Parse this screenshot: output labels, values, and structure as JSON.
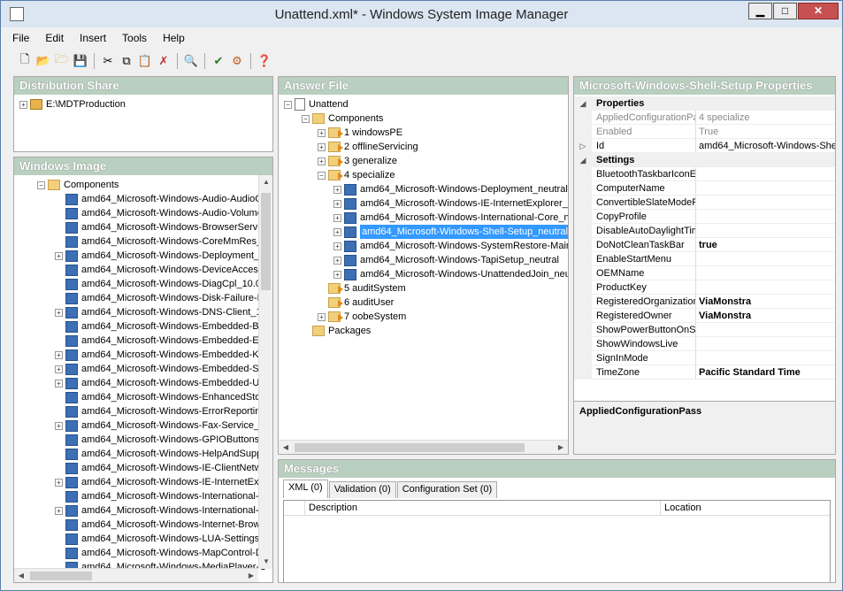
{
  "window": {
    "title": "Unattend.xml* - Windows System Image Manager",
    "minimize": "▁",
    "maximize": "□",
    "close": "✕"
  },
  "menu": [
    "File",
    "Edit",
    "Insert",
    "Tools",
    "Help"
  ],
  "toolbar_icons": [
    "new-icon",
    "open-icon",
    "open-folder-icon",
    "save-icon",
    "cut-icon",
    "copy-icon",
    "paste-icon",
    "delete-icon",
    "find-icon",
    "validate-icon",
    "create-config-set-icon",
    "help-icon"
  ],
  "distribution": {
    "header": "Distribution Share",
    "root": "E:\\MDTProduction"
  },
  "windows_image": {
    "header": "Windows Image",
    "components_label": "Components",
    "items": [
      {
        "label": "amd64_Microsoft-Windows-Audio-AudioC",
        "exp": false
      },
      {
        "label": "amd64_Microsoft-Windows-Audio-Volume",
        "exp": false
      },
      {
        "label": "amd64_Microsoft-Windows-BrowserServic",
        "exp": false
      },
      {
        "label": "amd64_Microsoft-Windows-CoreMmRes_",
        "exp": false
      },
      {
        "label": "amd64_Microsoft-Windows-Deployment_",
        "exp": true
      },
      {
        "label": "amd64_Microsoft-Windows-DeviceAcces",
        "exp": false
      },
      {
        "label": "amd64_Microsoft-Windows-DiagCpl_10.0",
        "exp": false
      },
      {
        "label": "amd64_Microsoft-Windows-Disk-Failure-D",
        "exp": false
      },
      {
        "label": "amd64_Microsoft-Windows-DNS-Client_1",
        "exp": true
      },
      {
        "label": "amd64_Microsoft-Windows-Embedded-Bo",
        "exp": false
      },
      {
        "label": "amd64_Microsoft-Windows-Embedded-Er",
        "exp": false
      },
      {
        "label": "amd64_Microsoft-Windows-Embedded-Ke",
        "exp": true
      },
      {
        "label": "amd64_Microsoft-Windows-Embedded-Sh",
        "exp": true
      },
      {
        "label": "amd64_Microsoft-Windows-Embedded-Ur",
        "exp": true
      },
      {
        "label": "amd64_Microsoft-Windows-EnhancedSto",
        "exp": false
      },
      {
        "label": "amd64_Microsoft-Windows-ErrorReporting",
        "exp": false
      },
      {
        "label": "amd64_Microsoft-Windows-Fax-Service_",
        "exp": true
      },
      {
        "label": "amd64_Microsoft-Windows-GPIOButtons_",
        "exp": false
      },
      {
        "label": "amd64_Microsoft-Windows-HelpAndSupp",
        "exp": false
      },
      {
        "label": "amd64_Microsoft-Windows-IE-ClientNetw",
        "exp": false
      },
      {
        "label": "amd64_Microsoft-Windows-IE-InternetExp",
        "exp": true
      },
      {
        "label": "amd64_Microsoft-Windows-International-C",
        "exp": false
      },
      {
        "label": "amd64_Microsoft-Windows-International-C",
        "exp": true
      },
      {
        "label": "amd64_Microsoft-Windows-Internet-Brows",
        "exp": false
      },
      {
        "label": "amd64_Microsoft-Windows-LUA-Settings_",
        "exp": false
      },
      {
        "label": "amd64_Microsoft-Windows-MapControl-D",
        "exp": false
      },
      {
        "label": "amd64_Microsoft-Windows-MediaPlayer-C",
        "exp": false
      }
    ]
  },
  "answer_file": {
    "header": "Answer File",
    "root": "Unattend",
    "components": "Components",
    "passes": [
      "1 windowsPE",
      "2 offlineServicing",
      "3 generalize",
      "4 specialize"
    ],
    "specialize_children": [
      "amd64_Microsoft-Windows-Deployment_neutral",
      "amd64_Microsoft-Windows-IE-InternetExplorer_n",
      "amd64_Microsoft-Windows-International-Core_ne",
      "amd64_Microsoft-Windows-Shell-Setup_neutral",
      "amd64_Microsoft-Windows-SystemRestore-Main_",
      "amd64_Microsoft-Windows-TapiSetup_neutral",
      "amd64_Microsoft-Windows-UnattendedJoin_neu"
    ],
    "selected_child": "amd64_Microsoft-Windows-Shell-Setup_neutral",
    "passes_after": [
      "5 auditSystem",
      "6 auditUser",
      "7 oobeSystem"
    ],
    "packages": "Packages"
  },
  "properties": {
    "header": "Microsoft-Windows-Shell-Setup Properties",
    "cat_properties": "Properties",
    "cat_settings": "Settings",
    "meta_rows": [
      {
        "name": "AppliedConfigurationPas",
        "value": "4 specialize",
        "dim": true
      },
      {
        "name": "Enabled",
        "value": "True",
        "dim": true
      },
      {
        "name": "Id",
        "value": "amd64_Microsoft-Windows-Shel",
        "dim": false
      }
    ],
    "settings": [
      {
        "name": "BluetoothTaskbarIconEn",
        "value": ""
      },
      {
        "name": "ComputerName",
        "value": ""
      },
      {
        "name": "ConvertibleSlateModePr",
        "value": ""
      },
      {
        "name": "CopyProfile",
        "value": ""
      },
      {
        "name": "DisableAutoDaylightTim",
        "value": ""
      },
      {
        "name": "DoNotCleanTaskBar",
        "value": "true"
      },
      {
        "name": "EnableStartMenu",
        "value": ""
      },
      {
        "name": "OEMName",
        "value": ""
      },
      {
        "name": "ProductKey",
        "value": ""
      },
      {
        "name": "RegisteredOrganization",
        "value": "ViaMonstra"
      },
      {
        "name": "RegisteredOwner",
        "value": "ViaMonstra"
      },
      {
        "name": "ShowPowerButtonOnSta",
        "value": ""
      },
      {
        "name": "ShowWindowsLive",
        "value": ""
      },
      {
        "name": "SignInMode",
        "value": ""
      },
      {
        "name": "TimeZone",
        "value": "Pacific Standard Time"
      }
    ],
    "description_title": "AppliedConfigurationPass"
  },
  "messages": {
    "header": "Messages",
    "tabs": [
      "XML (0)",
      "Validation (0)",
      "Configuration Set (0)"
    ],
    "columns": [
      "Description",
      "Location"
    ]
  }
}
